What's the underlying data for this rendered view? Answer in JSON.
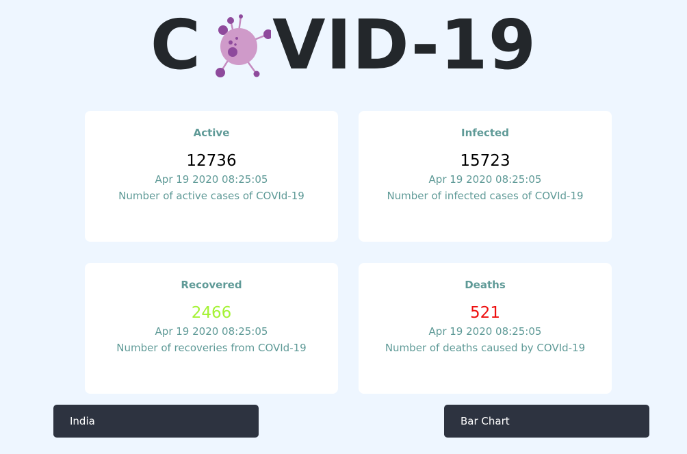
{
  "header": {
    "title_left": "C",
    "title_right": "VID-19",
    "logo_icon": "virus-icon"
  },
  "colors": {
    "background": "#eef6ff",
    "card": "#ffffff",
    "label": "#5f9a97",
    "recovered": "#a4f234",
    "deaths": "#ee0f0f",
    "dropdown": "#2d3340"
  },
  "cards": {
    "active": {
      "title": "Active",
      "value": "12736",
      "date": "Apr 19 2020 08:25:05",
      "description": "Number of active cases of COVId-19"
    },
    "infected": {
      "title": "Infected",
      "value": "15723",
      "date": "Apr 19 2020 08:25:05",
      "description": "Number of infected cases of COVId-19"
    },
    "recovered": {
      "title": "Recovered",
      "value": "2466",
      "date": "Apr 19 2020 08:25:05",
      "description": "Number of recoveries from COVId-19"
    },
    "deaths": {
      "title": "Deaths",
      "value": "521",
      "date": "Apr 19 2020 08:25:05",
      "description": "Number of deaths caused by COVId-19"
    }
  },
  "controls": {
    "country_select": "India",
    "chart_select": "Bar Chart"
  }
}
